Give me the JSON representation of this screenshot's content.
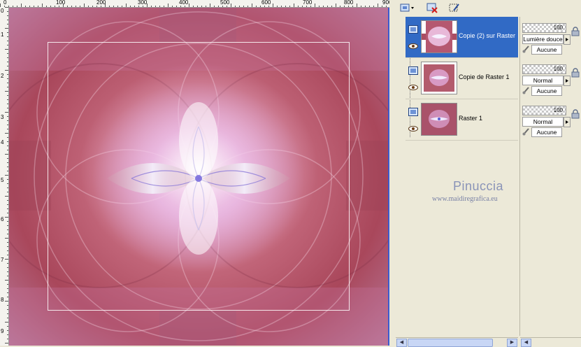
{
  "ruler": {
    "top_labels": [
      "0",
      "100",
      "200",
      "300",
      "400",
      "500",
      "600",
      "700",
      "800",
      "900"
    ],
    "left_labels": [
      "0",
      "1",
      "2",
      "3",
      "4",
      "5",
      "6",
      "7",
      "8",
      "9",
      "0"
    ]
  },
  "layers": [
    {
      "name": "Copie (2) sur Raster",
      "selected": true,
      "opacity": "100",
      "blend": "Lumière douce",
      "mask": "Aucune"
    },
    {
      "name": "Copie de Raster 1",
      "selected": false,
      "opacity": "100",
      "blend": "Normal",
      "mask": "Aucune"
    },
    {
      "name": "Raster 1",
      "selected": false,
      "opacity": "100",
      "blend": "Normal",
      "mask": "Aucune"
    }
  ],
  "watermark": {
    "title": "Pinuccia",
    "url": "www.maidiregrafica.eu"
  },
  "icons": {
    "new_layer": "new-layer-icon",
    "delete_layer": "delete-layer-icon",
    "edit": "edit-icon",
    "visibility": "eye-icon",
    "layer_type": "raster-layer-icon",
    "lock": "lock-icon",
    "mask": "mask-brush-icon"
  },
  "colors": {
    "selection": "#316ac5",
    "panel_bg": "#ece9d8",
    "canvas_border": "#3a5bd0"
  }
}
